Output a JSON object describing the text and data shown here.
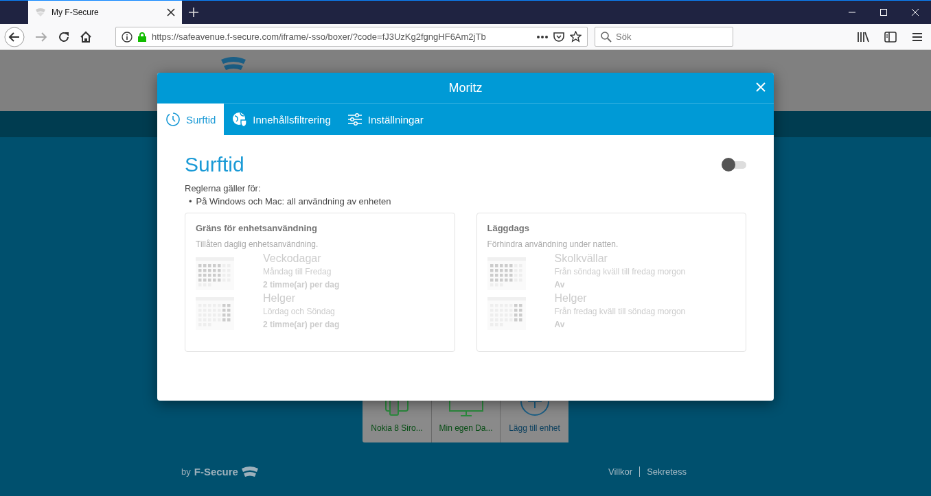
{
  "browser": {
    "tab": {
      "title": "My F-Secure",
      "selected": true
    },
    "nav": [
      {
        "kind": "back",
        "disabled": false
      },
      {
        "kind": "forward",
        "disabled": true
      },
      {
        "kind": "reload",
        "disabled": false
      },
      {
        "kind": "home",
        "disabled": false
      }
    ],
    "address": "https://safeavenue.f-secure.com/iframe/-sso/boxer/?code=fJ3UzKg2fgngHF6Am2jTb",
    "search": {
      "placeholder": "Sök"
    }
  },
  "page": {
    "devices": [
      {
        "kind": "phone",
        "label": "Nokia 8 Siro..."
      },
      {
        "kind": "computer",
        "label": "Min egen Da..."
      },
      {
        "kind": "add",
        "label": "Lägg till enhet"
      }
    ],
    "footer": {
      "brand_by": "by",
      "brand": "F-Secure",
      "links": [
        "Villkor",
        "Sekretess"
      ]
    }
  },
  "dialog": {
    "title": "Moritz",
    "tabs": [
      {
        "kind": "clock",
        "label": "Surftid",
        "selected": true
      },
      {
        "kind": "globe",
        "label": "Innehållsfiltrering",
        "selected": false
      },
      {
        "kind": "sliders",
        "label": "Inställningar",
        "selected": false
      }
    ],
    "heading": "Surftid",
    "toggle": {
      "on": false
    },
    "rules_label": "Reglerna gäller för:",
    "rules": [
      {
        "marker": "•",
        "text": "På Windows och Mac: all användning av enheten"
      }
    ],
    "cards": [
      {
        "title": "Gräns för enhetsanvändning",
        "subtitle": "Tillåten daglig enhetsanvändning.",
        "rows": [
          {
            "kind": "weekdays",
            "title": "Veckodagar",
            "detail": "Måndag till Fredag",
            "value": "2 timme(ar) per dag"
          },
          {
            "kind": "weekend",
            "title": "Helger",
            "detail": "Lördag och Söndag",
            "value": "2 timme(ar) per dag"
          }
        ]
      },
      {
        "title": "Läggdags",
        "subtitle": "Förhindra användning under natten.",
        "rows": [
          {
            "kind": "weekdays",
            "title": "Skolkvällar",
            "detail": "Från söndag kväll till fredag morgon",
            "value": "Av"
          },
          {
            "kind": "weekend",
            "title": "Helger",
            "detail": "Från fredag kväll till söndag morgon",
            "value": "Av"
          }
        ]
      }
    ]
  }
}
